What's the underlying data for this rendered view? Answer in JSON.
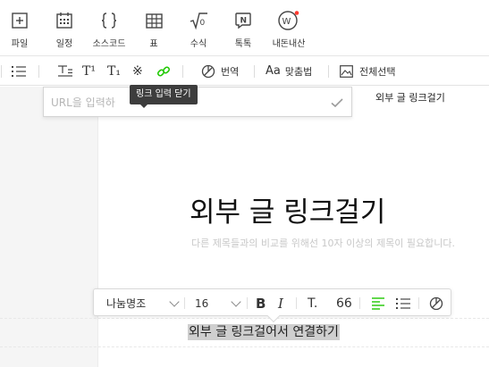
{
  "top_toolbar": {
    "items": [
      {
        "label": "파일",
        "icon": "file-plus-icon"
      },
      {
        "label": "일정",
        "icon": "calendar-icon"
      },
      {
        "label": "소스코드",
        "icon": "code-braces-icon"
      },
      {
        "label": "표",
        "icon": "table-icon"
      },
      {
        "label": "수식",
        "icon": "formula-icon"
      },
      {
        "label": "톡톡",
        "icon": "talktalk-icon"
      },
      {
        "label": "내돈내산",
        "icon": "my-money-icon"
      }
    ],
    "notification_color": "#ff3b30"
  },
  "format_toolbar": {
    "superscript_glyph": "T¹",
    "subscript_glyph": "T₁",
    "special_char_glyph": "※",
    "translate_label": "번역",
    "spellcheck_label": "맞춤법",
    "spellcheck_glyph": "Aa",
    "select_all_label": "전체선택",
    "link_color": "#1ec800"
  },
  "link_popup": {
    "placeholder": "URL을 입력하",
    "tooltip": "링크 입력 닫기"
  },
  "right_label": "외부 글 링크걸기",
  "document": {
    "title": "외부 글 링크걸기",
    "hint": "다른 제목들과의 비교를 위해선 10자 이상의 제목이 필요합니다.",
    "selected_text": "외부 글 링크걸어서 연결하기"
  },
  "floating_toolbar": {
    "font_name": "나눔명조",
    "font_size": "16",
    "bold_glyph": "B",
    "italic_glyph": "I",
    "text_style_glyph": "T.",
    "quote_glyph": "66",
    "align_color": "#1ec800"
  }
}
